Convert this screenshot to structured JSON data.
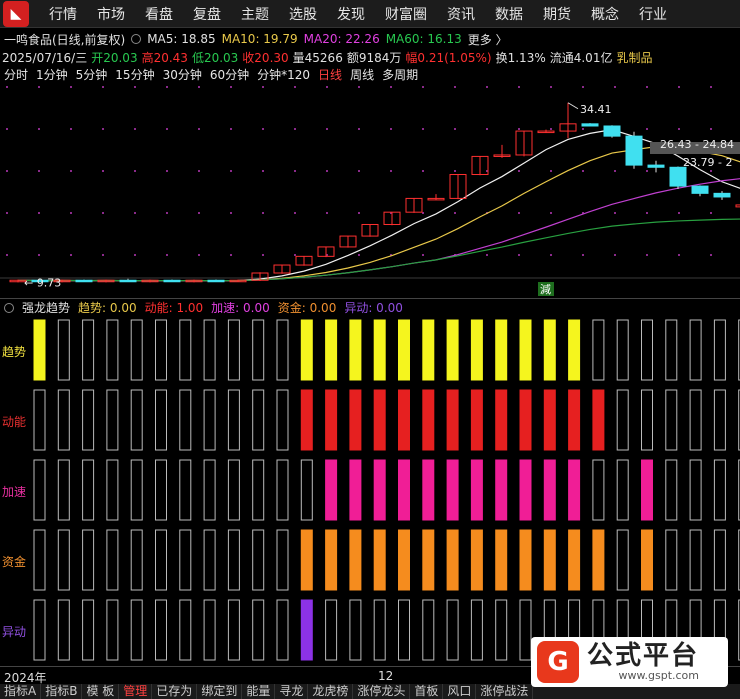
{
  "nav": {
    "logo_icon": "app-logo-icon",
    "items": [
      "行情",
      "市场",
      "看盘",
      "复盘",
      "主题",
      "选股",
      "发现",
      "财富圈",
      "资讯",
      "数据",
      "期货",
      "概念",
      "行业"
    ]
  },
  "stock": {
    "name": "一鸣食品(日线,前复权)",
    "ma5": "MA5: 18.85",
    "ma10": "MA10: 19.79",
    "ma20": "MA20: 22.26",
    "ma60": "MA60: 16.13",
    "more": "更多 〉",
    "date": "2025/07/16/三",
    "open": "开20.03",
    "high": "高20.43",
    "low": "低20.03",
    "close": "收20.30",
    "volume": "量45266",
    "amount": "额9184万",
    "amplitude": "幅0.21(1.05%)",
    "turnover": "换1.13%",
    "float_cap": "流通4.01亿",
    "industry": "乳制品"
  },
  "periods": {
    "items": [
      "分时",
      "1分钟",
      "5分钟",
      "15分钟",
      "30分钟",
      "60分钟",
      "分钟*120",
      "日线",
      "周线",
      "多周期"
    ],
    "active": "日线"
  },
  "chart_labels": {
    "high_price": "34.41",
    "low_price": "9.73",
    "range_1": "26.43 - 24.84",
    "range_2": "23.79 - 2",
    "reduce_mark": "減"
  },
  "chart_data": {
    "type": "candlestick",
    "ohlc": [
      {
        "o": 9.8,
        "h": 10.0,
        "l": 9.6,
        "c": 9.9
      },
      {
        "o": 9.9,
        "h": 10.1,
        "l": 9.7,
        "c": 9.8
      },
      {
        "o": 9.8,
        "h": 10.0,
        "l": 9.6,
        "c": 9.9
      },
      {
        "o": 9.9,
        "h": 10.0,
        "l": 9.7,
        "c": 9.8
      },
      {
        "o": 9.8,
        "h": 10.0,
        "l": 9.6,
        "c": 9.9
      },
      {
        "o": 9.9,
        "h": 10.1,
        "l": 9.7,
        "c": 9.8
      },
      {
        "o": 9.8,
        "h": 10.0,
        "l": 9.6,
        "c": 9.9
      },
      {
        "o": 9.9,
        "h": 10.0,
        "l": 9.7,
        "c": 9.8
      },
      {
        "o": 9.8,
        "h": 10.0,
        "l": 9.6,
        "c": 9.9
      },
      {
        "o": 9.9,
        "h": 10.0,
        "l": 9.73,
        "c": 9.8
      },
      {
        "o": 9.8,
        "h": 10.0,
        "l": 9.73,
        "c": 9.9
      },
      {
        "o": 9.9,
        "h": 11.0,
        "l": 9.8,
        "c": 10.9
      },
      {
        "o": 10.9,
        "h": 12.0,
        "l": 10.8,
        "c": 12.0
      },
      {
        "o": 12.0,
        "h": 13.2,
        "l": 11.9,
        "c": 13.2
      },
      {
        "o": 13.2,
        "h": 14.5,
        "l": 13.1,
        "c": 14.5
      },
      {
        "o": 14.5,
        "h": 16.0,
        "l": 14.4,
        "c": 16.0
      },
      {
        "o": 16.0,
        "h": 17.6,
        "l": 15.9,
        "c": 17.6
      },
      {
        "o": 17.6,
        "h": 19.3,
        "l": 17.5,
        "c": 19.3
      },
      {
        "o": 19.3,
        "h": 21.2,
        "l": 19.2,
        "c": 21.2
      },
      {
        "o": 21.2,
        "h": 21.8,
        "l": 21.0,
        "c": 21.2
      },
      {
        "o": 21.2,
        "h": 24.5,
        "l": 21.1,
        "c": 24.5
      },
      {
        "o": 24.5,
        "h": 27.0,
        "l": 24.4,
        "c": 27.0
      },
      {
        "o": 27.0,
        "h": 28.6,
        "l": 26.8,
        "c": 27.2
      },
      {
        "o": 27.2,
        "h": 30.5,
        "l": 27.0,
        "c": 30.5
      },
      {
        "o": 30.5,
        "h": 30.7,
        "l": 30.3,
        "c": 30.5
      },
      {
        "o": 30.5,
        "h": 34.41,
        "l": 29.5,
        "c": 31.5
      },
      {
        "o": 31.5,
        "h": 31.6,
        "l": 31.2,
        "c": 31.2
      },
      {
        "o": 31.2,
        "h": 31.3,
        "l": 29.6,
        "c": 29.8
      },
      {
        "o": 29.8,
        "h": 30.4,
        "l": 25.3,
        "c": 25.8
      },
      {
        "o": 25.8,
        "h": 26.4,
        "l": 24.8,
        "c": 25.5
      },
      {
        "o": 25.5,
        "h": 25.6,
        "l": 22.5,
        "c": 22.9
      },
      {
        "o": 22.9,
        "h": 23.0,
        "l": 21.5,
        "c": 21.9
      },
      {
        "o": 21.9,
        "h": 22.2,
        "l": 21.0,
        "c": 21.4
      },
      {
        "o": 20.03,
        "h": 20.43,
        "l": 20.03,
        "c": 20.3
      }
    ],
    "ylim": [
      8,
      37
    ]
  },
  "indicator": {
    "name": "强龙趋势",
    "trend": "趋势: 0.00",
    "momentum": "动能: 1.00",
    "accel": "加速: 0.00",
    "capital": "资金: 0.00",
    "anomaly": "异动: 0.00",
    "rows": [
      {
        "label": "趋势",
        "color": "#f5f51e",
        "label_color": "#f0e040",
        "fill": [
          1,
          0,
          0,
          0,
          0,
          0,
          0,
          0,
          0,
          0,
          0,
          1,
          1,
          1,
          1,
          1,
          1,
          1,
          1,
          1,
          1,
          1,
          1,
          0,
          0,
          0,
          0,
          0,
          0,
          0,
          0
        ]
      },
      {
        "label": "动能",
        "color": "#e62020",
        "label_color": "#e83030",
        "fill": [
          0,
          0,
          0,
          0,
          0,
          0,
          0,
          0,
          0,
          0,
          0,
          1,
          1,
          1,
          1,
          1,
          1,
          1,
          1,
          1,
          1,
          1,
          1,
          1,
          0,
          0,
          0,
          0,
          0,
          0,
          0
        ]
      },
      {
        "label": "加速",
        "color": "#f01e96",
        "label_color": "#e830a0",
        "fill": [
          0,
          0,
          0,
          0,
          0,
          0,
          0,
          0,
          0,
          0,
          0,
          0,
          1,
          1,
          1,
          1,
          1,
          1,
          1,
          1,
          1,
          1,
          1,
          0,
          0,
          1,
          0,
          0,
          0,
          0,
          0
        ]
      },
      {
        "label": "资金",
        "color": "#f58c1e",
        "label_color": "#f09030",
        "fill": [
          0,
          0,
          0,
          0,
          0,
          0,
          0,
          0,
          0,
          0,
          0,
          1,
          1,
          1,
          1,
          1,
          1,
          1,
          1,
          1,
          1,
          1,
          1,
          1,
          0,
          1,
          0,
          0,
          0,
          0,
          0
        ]
      },
      {
        "label": "异动",
        "color": "#8c32e6",
        "label_color": "#9050e0",
        "fill": [
          0,
          0,
          0,
          0,
          0,
          0,
          0,
          0,
          0,
          0,
          0,
          1,
          0,
          0,
          0,
          0,
          0,
          0,
          0,
          0,
          0,
          0,
          0,
          0,
          0,
          0,
          0,
          0,
          0,
          0,
          0
        ]
      }
    ]
  },
  "date_axis": {
    "left": "2024年",
    "mid": "12"
  },
  "bottom_tabs": {
    "items": [
      "指标A",
      "指标B",
      "模 板",
      "管理",
      "已存为",
      "绑定到",
      "能量",
      "寻龙",
      "龙虎榜",
      "涨停龙头",
      "首板",
      "风口",
      "涨停战法"
    ],
    "active": "管理"
  },
  "badge": {
    "icon": "gspt-logo-icon",
    "title": "公式平台",
    "url": "www.gspt.com"
  }
}
